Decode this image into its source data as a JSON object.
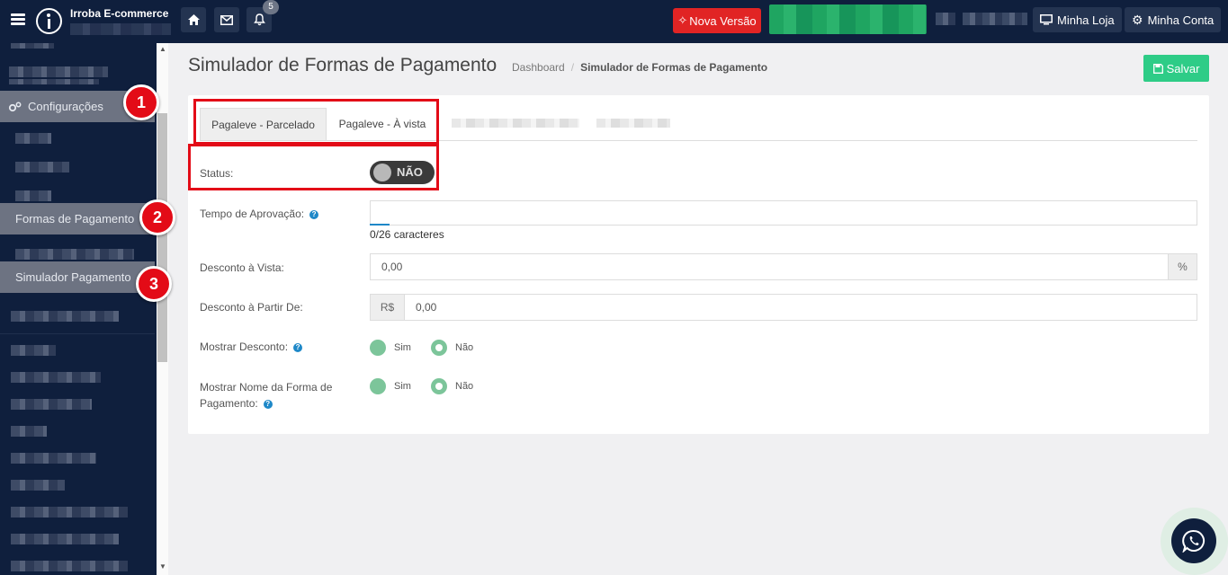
{
  "header": {
    "brand": "Irroba E-commerce",
    "notifications_count": "5",
    "nova_versao": "Nova Versão",
    "minha_loja": "Minha Loja",
    "minha_conta": "Minha Conta"
  },
  "sidebar": {
    "configuracoes": "Configurações",
    "formas_pagamento": "Formas de Pagamento",
    "simulador_pagamento": "Simulador Pagamento"
  },
  "markers": [
    "1",
    "2",
    "3"
  ],
  "page": {
    "title": "Simulador de Formas de Pagamento",
    "breadcrumb": [
      "Dashboard",
      "Simulador de Formas de Pagamento"
    ],
    "breadcrumb_sep": "/",
    "save_label": "Salvar"
  },
  "tabs": [
    {
      "label": "Pagaleve - Parcelado",
      "active": true
    },
    {
      "label": "Pagaleve - À vista",
      "active": false
    }
  ],
  "form": {
    "status_label": "Status:",
    "status_value": "NÃO",
    "tempo_label": "Tempo de Aprovação:",
    "tempo_value": "",
    "tempo_counter": "0/26 caracteres",
    "desconto_vista_label": "Desconto à Vista:",
    "desconto_vista_value": "0,00",
    "desconto_vista_suffix": "%",
    "desconto_partir_label": "Desconto à Partir De:",
    "desconto_partir_prefix": "R$",
    "desconto_partir_value": "0,00",
    "mostrar_desconto_label": "Mostrar Desconto:",
    "mostrar_nome_label_1": "Mostrar Nome da Forma de",
    "mostrar_nome_label_2": "Pagamento:",
    "opt_sim": "Sim",
    "opt_nao": "Não",
    "help_glyph": "?"
  },
  "colors": {
    "topbar": "#0f1f3d",
    "accent_red": "#e30b17",
    "save_green": "#2ecc87",
    "radio_green": "#7cc59a",
    "help_blue": "#1e88c8"
  },
  "icons": [
    "menu-icon",
    "home-icon",
    "mail-icon",
    "bell-icon",
    "sparkle-icon",
    "monitor-icon",
    "gear-icon",
    "cogs-icon",
    "save-icon",
    "whatsapp-icon"
  ]
}
